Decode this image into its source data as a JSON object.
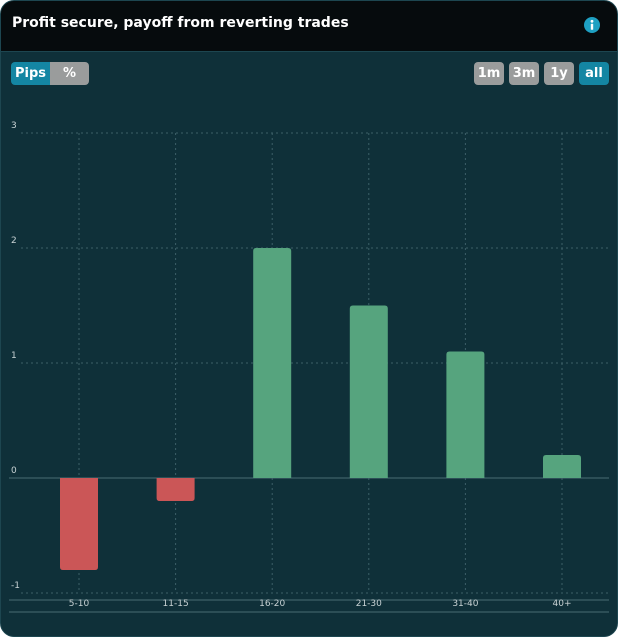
{
  "title": "Profit secure, payoff from reverting trades",
  "info_icon": "info-icon",
  "unit_toggle": [
    {
      "label": "Pips",
      "active": true
    },
    {
      "label": "%",
      "active": false
    }
  ],
  "range_buttons": [
    {
      "label": "1m",
      "active": false
    },
    {
      "label": "3m",
      "active": false
    },
    {
      "label": "1y",
      "active": false
    },
    {
      "label": "all",
      "active": true
    }
  ],
  "colors": {
    "positive": "#56a47e",
    "negative": "#cb5657",
    "active_button": "#1486a3",
    "inactive_button": "#9a9c9c",
    "background": "#0f3039",
    "header": "#060b0d"
  },
  "chart_data": {
    "type": "bar",
    "categories": [
      "5-10",
      "11-15",
      "16-20",
      "21-30",
      "31-40",
      "40+"
    ],
    "values": [
      -0.8,
      -0.2,
      2.0,
      1.5,
      1.1,
      0.2
    ],
    "ylim": [
      -1,
      3
    ],
    "yticks": [
      "-1",
      "0",
      "1",
      "2",
      "3"
    ],
    "grid": true
  }
}
